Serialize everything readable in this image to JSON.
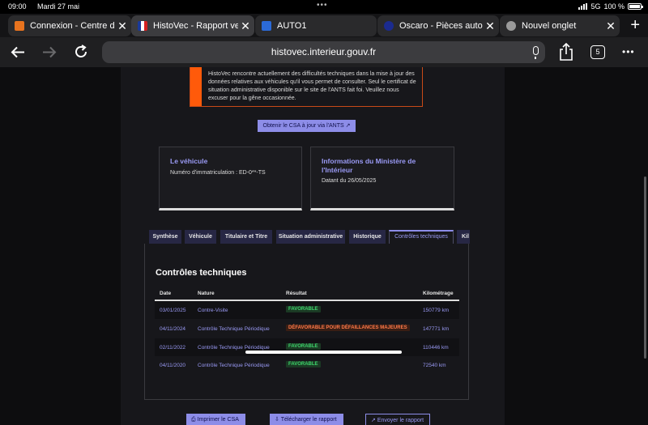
{
  "status_bar": {
    "time": "09:00",
    "date": "Mardi 27 mai",
    "network": "5G",
    "battery": "100 %"
  },
  "tabs": [
    {
      "title": "Connexion - Centre d",
      "favicon_color": "#e8731e"
    },
    {
      "title": "HistoVec - Rapport ve",
      "favicon_color": "#ffffff"
    },
    {
      "title": "AUTO1",
      "favicon_color": "#2b6ad8"
    },
    {
      "title": "Oscaro - Pièces auto",
      "favicon_color": "#1b2b8f"
    },
    {
      "title": "Nouvel onglet",
      "favicon_color": "#9a9a9a"
    }
  ],
  "toolbar": {
    "url": "histovec.interieur.gouv.fr",
    "tab_count": "5"
  },
  "alert": {
    "text": "HistoVec rencontre actuellement des difficultés techniques dans la mise à jour des données relatives aux véhicules qu'il vous permet de consulter. Seul le certificat de situation administrative disponible sur le site de l'ANTS fait foi. Veuillez nous excuser pour la gêne occasionnée."
  },
  "csa_button": "Obtenir le CSA à jour via l'ANTS",
  "cards": {
    "vehicle": {
      "title": "Le véhicule",
      "subtitle": "Numéro d'immatriculation : ED-0**-TS"
    },
    "ministry": {
      "title_line1": "Informations du Ministère de",
      "title_line2": "l'Intérieur",
      "subtitle": "Datant du 26/05/2025"
    }
  },
  "page_tabs": [
    "Synthèse",
    "Véhicule",
    "Titulaire et Titre",
    "Situation administrative",
    "Historique",
    "Contrôles techniques",
    "Kil"
  ],
  "section": {
    "title": "Contrôles techniques",
    "columns": [
      "Date",
      "Nature",
      "Résultat",
      "Kilométrage"
    ],
    "rows": [
      {
        "date": "03/01/2025",
        "nature": "Contre-Visite",
        "result": "FAVORABLE",
        "km": "150779 km",
        "status": "ok"
      },
      {
        "date": "04/11/2024",
        "nature": "Contrôle Technique Périodique",
        "result": "DÉFAVORABLE POUR DÉFAILLANCES MAJEURES",
        "km": "147771 km",
        "status": "ko"
      },
      {
        "date": "02/11/2022",
        "nature": "Contrôle Technique Périodique",
        "result": "FAVORABLE",
        "km": "110446 km",
        "status": "ok"
      },
      {
        "date": "04/11/2020",
        "nature": "Contrôle Technique Périodique",
        "result": "FAVORABLE",
        "km": "72540 km",
        "status": "ok"
      }
    ]
  },
  "bottom_actions": {
    "print": "Imprimer le CSA",
    "download": "Télécharger le rapport",
    "send": "Envoyer le rapport"
  },
  "colors": {
    "accent": "#8d8de8",
    "warning": "#ff5a0a",
    "favorable": "#3ed36b",
    "defavorable": "#ff7a4a"
  }
}
